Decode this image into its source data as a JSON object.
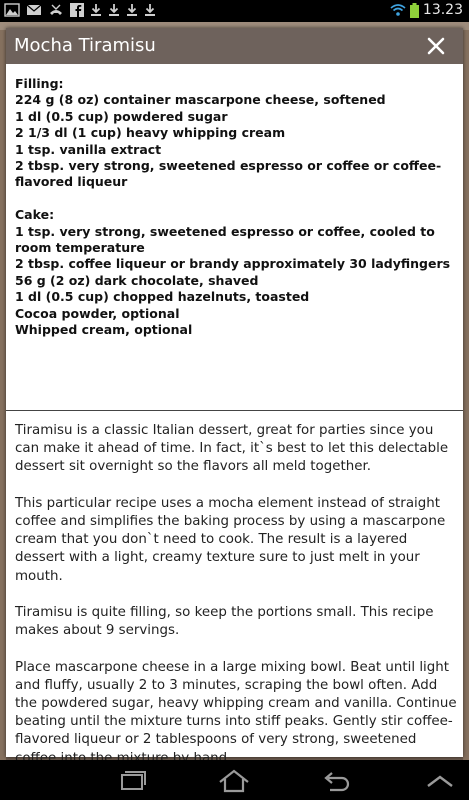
{
  "status_bar": {
    "time": "13.23",
    "icons": [
      "gallery-icon",
      "mail-icon",
      "missed-call-icon",
      "facebook-icon",
      "download-icon",
      "download-icon",
      "download-icon",
      "download-icon"
    ]
  },
  "dialog": {
    "title": "Mocha Tiramisu",
    "close_icon": "close-icon"
  },
  "ingredients": {
    "filling_heading": "Filling:",
    "filling": [
      "224 g (8 oz) container mascarpone cheese, softened",
      "1 dl (0.5 cup) powdered sugar",
      "2 1/3 dl (1 cup) heavy whipping cream",
      "1 tsp. vanilla extract",
      "2 tbsp. very strong, sweetened espresso or coffee or coffee-flavored liqueur"
    ],
    "cake_heading": "Cake:",
    "cake": [
      "1 tsp. very strong, sweetened espresso or coffee, cooled to room temperature",
      "2 tbsp. coffee liqueur or brandy approximately 30 ladyfingers",
      "56 g (2 oz) dark chocolate, shaved",
      "1 dl (0.5 cup) chopped hazelnuts, toasted",
      "Cocoa powder, optional",
      "Whipped cream, optional"
    ]
  },
  "description": [
    "Tiramisu is a classic Italian dessert, great for parties since you can make it ahead of time. In fact, it`s best to let this delectable dessert sit overnight so the flavors all meld together.",
    "This particular recipe uses a mocha element instead of straight coffee and simplifies the baking process by using a mascarpone cream that you don`t need to cook. The result is a layered dessert with a light, creamy texture sure to just melt in your mouth.",
    "Tiramisu is quite filling, so keep the portions small. This recipe makes about 9 servings.",
    "Place mascarpone cheese in a large mixing bowl. Beat until light and fluffy, usually 2 to 3 minutes, scraping the bowl often. Add the powdered sugar, heavy whipping cream and vanilla. Continue beating until the mixture turns into stiff peaks. Gently stir coffee-flavored liqueur or 2 tablespoons of very strong, sweetened coffee into the mixture by hand."
  ],
  "nav_bar": {
    "icons": [
      "recent-apps-icon",
      "home-icon",
      "back-icon",
      "menu-up-icon"
    ]
  },
  "colors": {
    "header": "#6e625c",
    "background": "#6b5a4e"
  }
}
